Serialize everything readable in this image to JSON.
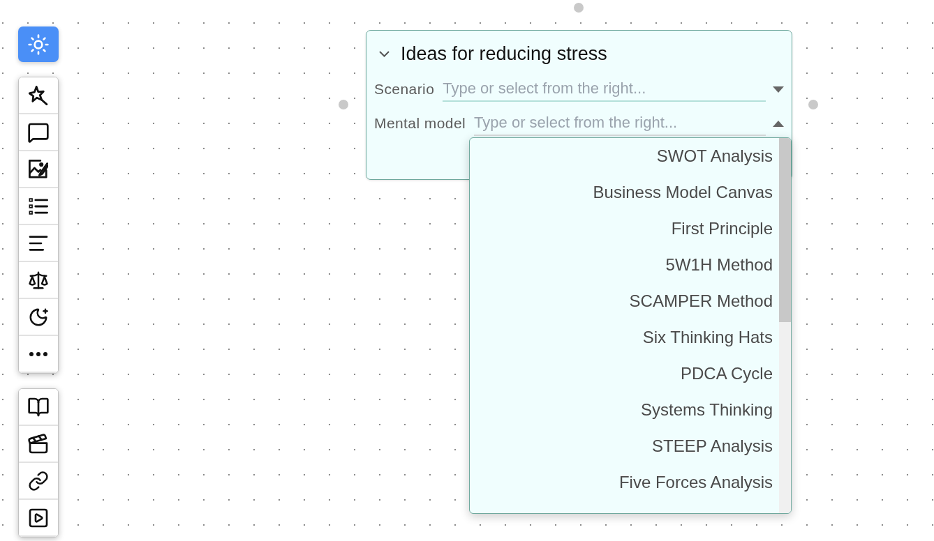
{
  "toolbar": {
    "theme_button": {
      "kind": "sun",
      "selected": true
    },
    "groups": [
      {
        "tools": [
          {
            "kind": "wand",
            "selected": false
          },
          {
            "kind": "comment",
            "selected": false
          },
          {
            "kind": "image",
            "selected": false
          },
          {
            "kind": "checklist",
            "selected": false
          },
          {
            "kind": "text",
            "selected": false
          },
          {
            "kind": "scale",
            "selected": false
          },
          {
            "kind": "moon",
            "selected": false
          },
          {
            "kind": "more",
            "selected": false
          }
        ]
      },
      {
        "tools": [
          {
            "kind": "book",
            "selected": false
          },
          {
            "kind": "clapper",
            "selected": false
          },
          {
            "kind": "link",
            "selected": false
          },
          {
            "kind": "video",
            "selected": false
          }
        ]
      }
    ]
  },
  "card": {
    "title": "Ideas for reducing stress",
    "expanded": true,
    "fields": [
      {
        "label": "Scenario",
        "placeholder": "Type or select from the right...",
        "open": false
      },
      {
        "label": "Mental model",
        "placeholder": "Type or select from the right...",
        "open": true,
        "options": [
          {
            "label": "SWOT Analysis",
            "selected": false
          },
          {
            "label": "Business Model Canvas",
            "selected": false
          },
          {
            "label": "First Principle",
            "selected": false
          },
          {
            "label": "5W1H Method",
            "selected": false
          },
          {
            "label": "SCAMPER Method",
            "selected": false
          },
          {
            "label": "Six Thinking Hats",
            "selected": false
          },
          {
            "label": "PDCA Cycle",
            "selected": false
          },
          {
            "label": "Systems Thinking",
            "selected": false
          },
          {
            "label": "STEEP Analysis",
            "selected": false
          },
          {
            "label": "Five Forces Analysis",
            "selected": false
          }
        ]
      }
    ]
  }
}
